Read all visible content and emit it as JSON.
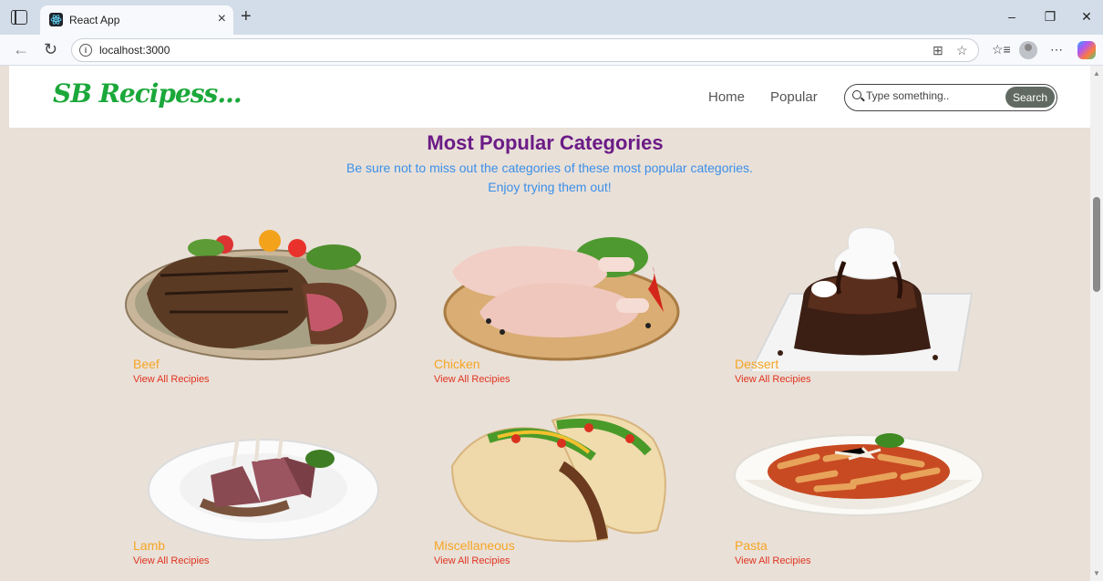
{
  "browser": {
    "tab_title": "React App",
    "url": "localhost:3000",
    "new_tab_symbol": "+",
    "close_symbol": "×"
  },
  "site": {
    "logo": "SB Recipess...",
    "nav": [
      "Home",
      "Popular"
    ],
    "search": {
      "placeholder": "Type something..",
      "button": "Search"
    }
  },
  "main": {
    "heading": "Most Popular Categories",
    "subtitle": "Be sure not to miss out the categories of these most popular categories. Enjoy trying them out!",
    "categories": [
      {
        "name": "Beef",
        "link": "View All Recipies"
      },
      {
        "name": "Chicken",
        "link": "View All Recipies"
      },
      {
        "name": "Dessert",
        "link": "View All Recipies"
      },
      {
        "name": "Lamb",
        "link": "View All Recipies"
      },
      {
        "name": "Miscellaneous",
        "link": "View All Recipies"
      },
      {
        "name": "Pasta",
        "link": "View All Recipies"
      }
    ]
  },
  "colors": {
    "page_bg": "#e9e0d8",
    "heading": "#6b1b86",
    "subtitle": "#3b8fe8",
    "category_name": "#f5a623",
    "category_link": "#e0341f",
    "logo": "#1ba83a",
    "search_button": "#606a62"
  }
}
